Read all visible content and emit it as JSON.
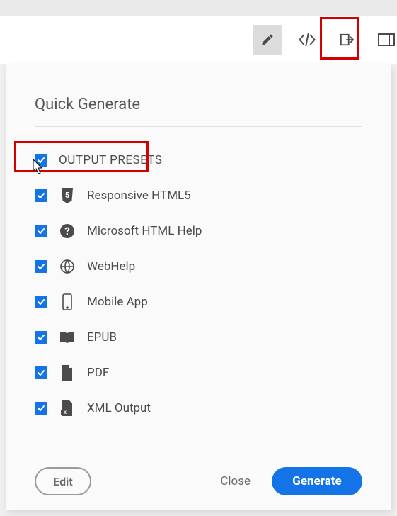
{
  "panel": {
    "title": "Quick Generate",
    "master_label": "OUTPUT PRESETS",
    "items": [
      {
        "label": "Responsive HTML5"
      },
      {
        "label": "Microsoft HTML Help"
      },
      {
        "label": "WebHelp"
      },
      {
        "label": "Mobile App"
      },
      {
        "label": "EPUB"
      },
      {
        "label": "PDF"
      },
      {
        "label": "XML Output"
      }
    ],
    "edit_label": "Edit",
    "close_label": "Close",
    "generate_label": "Generate"
  }
}
